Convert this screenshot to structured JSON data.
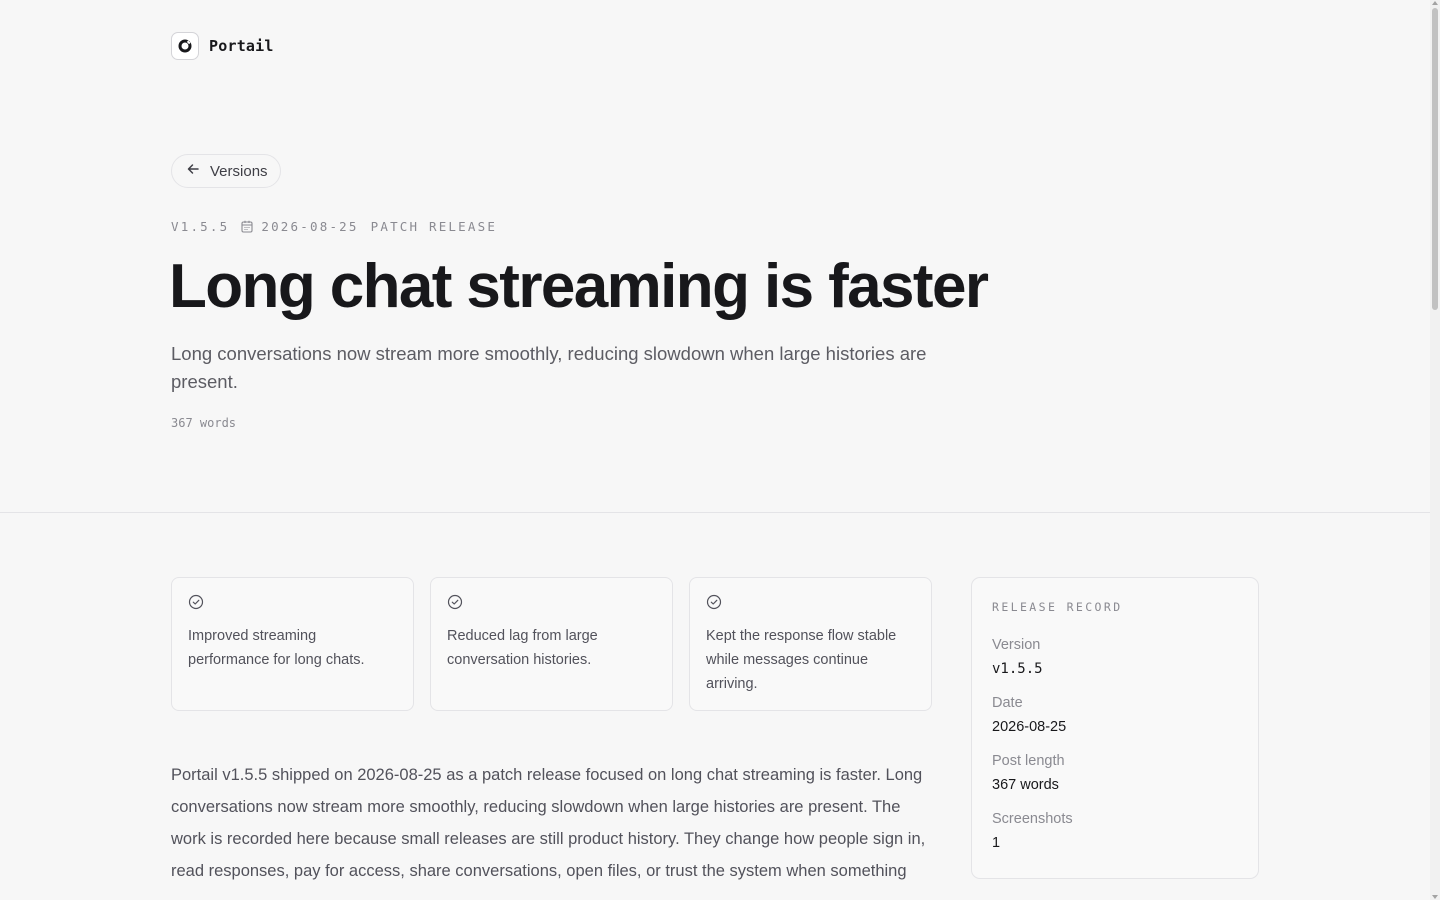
{
  "brand": {
    "name": "Portail",
    "icon": "portail-logo-icon"
  },
  "nav": {
    "back_label": "Versions",
    "back_icon": "arrow-left-icon"
  },
  "post": {
    "version": "V1.5.5",
    "date": "2026-08-25",
    "date_icon": "calendar-icon",
    "kind": "PATCH RELEASE",
    "title": "Long chat streaming is faster",
    "subtitle": "Long conversations now stream more smoothly, reducing slowdown when large histories are present.",
    "word_count": "367 words"
  },
  "highlights": [
    {
      "icon": "check-circle-icon",
      "text": "Improved streaming performance for long chats."
    },
    {
      "icon": "check-circle-icon",
      "text": "Reduced lag from large conversation histories."
    },
    {
      "icon": "check-circle-icon",
      "text": "Kept the response flow stable while messages continue arriving."
    }
  ],
  "body": {
    "paragraph": "Portail v1.5.5 shipped on 2026-08-25 as a patch release focused on long chat streaming is faster. Long conversations now stream more smoothly, reducing slowdown when large histories are present. The work is recorded here because small releases are still product history. They change how people sign in, read responses, pay for access, share conversations, open files, or trust the system when something"
  },
  "record": {
    "heading": "RELEASE RECORD",
    "rows": [
      {
        "label": "Version",
        "value": "v1.5.5"
      },
      {
        "label": "Date",
        "value": "2026-08-25"
      },
      {
        "label": "Post length",
        "value": "367 words"
      },
      {
        "label": "Screenshots",
        "value": "1"
      }
    ]
  },
  "colors": {
    "background": "#f7f7f7",
    "text": "#18181b",
    "muted": "#8a8a91",
    "border": "#e4e4e7"
  }
}
